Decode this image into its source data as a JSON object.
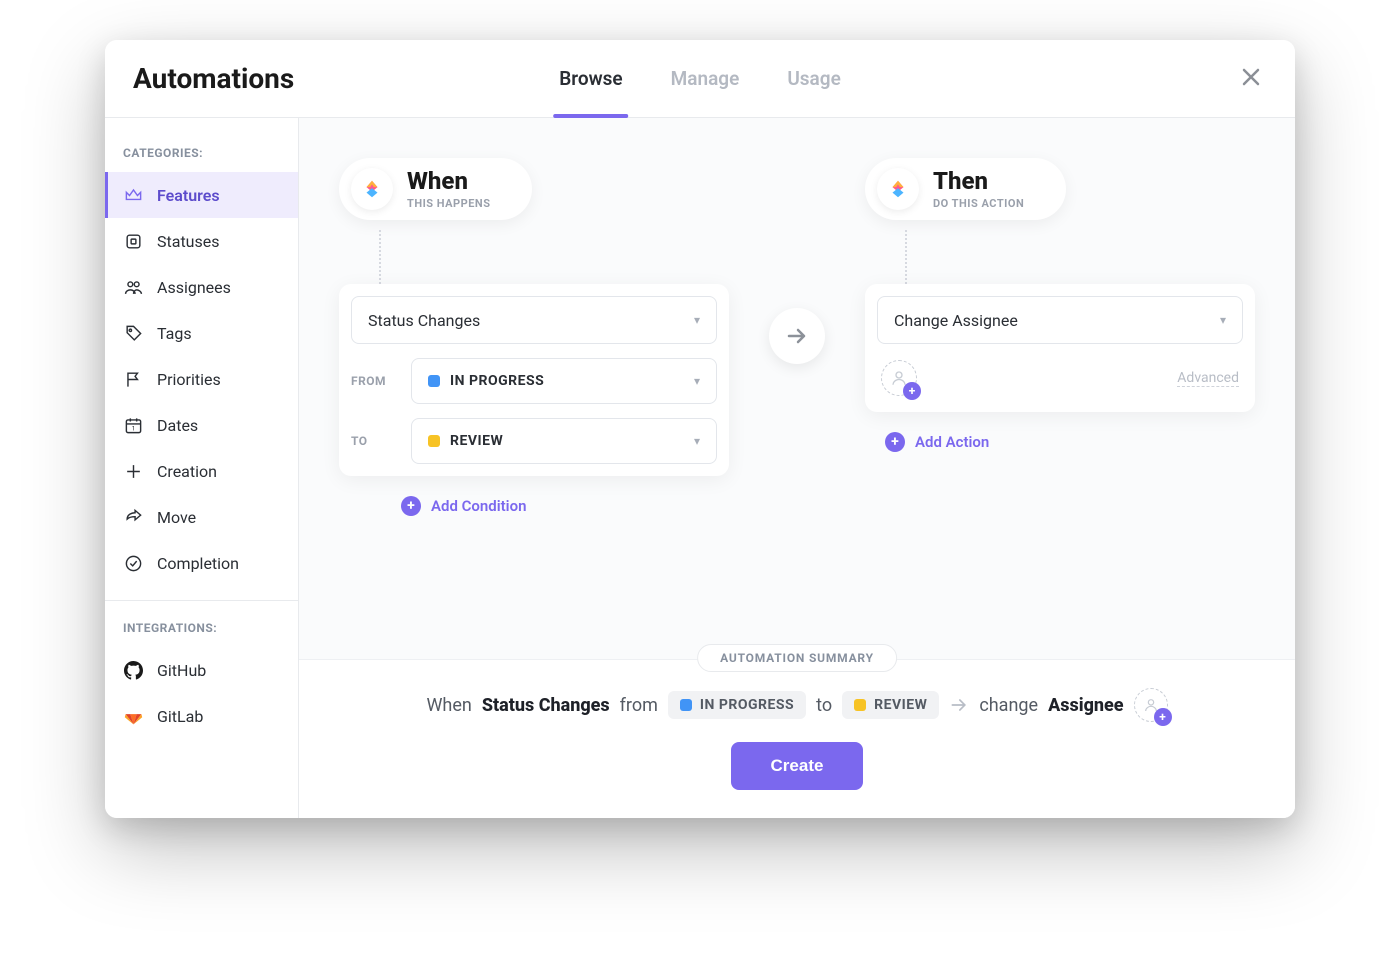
{
  "header": {
    "title": "Automations",
    "tabs": [
      {
        "label": "Browse",
        "active": true
      },
      {
        "label": "Manage",
        "active": false
      },
      {
        "label": "Usage",
        "active": false
      }
    ]
  },
  "sidebar": {
    "categories_label": "CATEGORIES:",
    "integrations_label": "INTEGRATIONS:",
    "categories": [
      {
        "label": "Features",
        "icon": "crown-icon",
        "active": true
      },
      {
        "label": "Statuses",
        "icon": "square-icon",
        "active": false
      },
      {
        "label": "Assignees",
        "icon": "people-icon",
        "active": false
      },
      {
        "label": "Tags",
        "icon": "tag-icon",
        "active": false
      },
      {
        "label": "Priorities",
        "icon": "flag-icon",
        "active": false
      },
      {
        "label": "Dates",
        "icon": "calendar-icon",
        "active": false
      },
      {
        "label": "Creation",
        "icon": "plus-icon",
        "active": false
      },
      {
        "label": "Move",
        "icon": "share-icon",
        "active": false
      },
      {
        "label": "Completion",
        "icon": "check-circle-icon",
        "active": false
      }
    ],
    "integrations": [
      {
        "label": "GitHub",
        "icon": "github-icon"
      },
      {
        "label": "GitLab",
        "icon": "gitlab-icon"
      }
    ]
  },
  "builder": {
    "when": {
      "title": "When",
      "subtitle": "THIS HAPPENS",
      "trigger": "Status Changes",
      "from_label": "FROM",
      "to_label": "TO",
      "from_status": {
        "name": "IN PROGRESS",
        "color": "#4194f6"
      },
      "to_status": {
        "name": "REVIEW",
        "color": "#f7c325"
      },
      "add_condition": "Add Condition"
    },
    "then": {
      "title": "Then",
      "subtitle": "DO THIS ACTION",
      "action": "Change Assignee",
      "advanced": "Advanced",
      "add_action": "Add Action"
    }
  },
  "summary": {
    "label": "AUTOMATION SUMMARY",
    "when_word": "When",
    "trigger": "Status Changes",
    "from_word": "from",
    "from_status": {
      "name": "IN PROGRESS",
      "color": "#4194f6"
    },
    "to_word": "to",
    "to_status": {
      "name": "REVIEW",
      "color": "#f7c325"
    },
    "change_word": "change",
    "target": "Assignee"
  },
  "create_button": "Create",
  "colors": {
    "accent": "#7b68ee"
  }
}
